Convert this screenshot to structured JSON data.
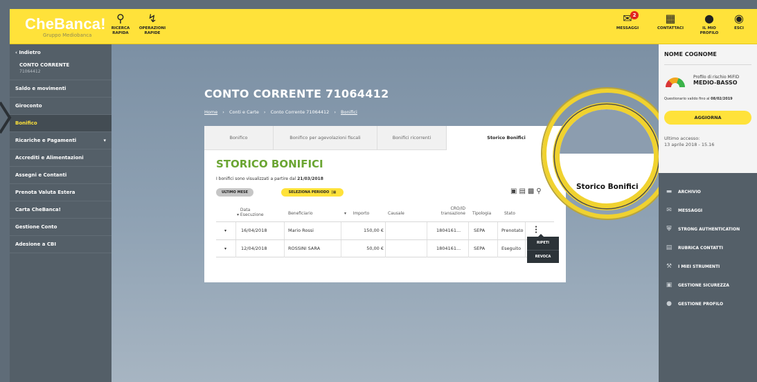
{
  "brand": {
    "name": "CheBanca!",
    "group": "Gruppo Mediobanca"
  },
  "topbar": {
    "left_items": [
      {
        "icon": "search-icon",
        "label1": "RICERCA",
        "label2": "RAPIDA"
      },
      {
        "icon": "lightning-icon",
        "label1": "OPERAZIONI",
        "label2": "RAPIDE"
      }
    ],
    "right_items": [
      {
        "icon": "message-icon",
        "label1": "MESSAGGI",
        "label2": "",
        "badge": "2"
      },
      {
        "icon": "contact-icon",
        "label1": "CONTATTACI",
        "label2": ""
      },
      {
        "icon": "user-icon",
        "label1": "IL MIO",
        "label2": "PROFILO"
      },
      {
        "icon": "exit-icon",
        "label1": "ESCI",
        "label2": ""
      }
    ]
  },
  "sidebar": {
    "back": "Indietro",
    "account_title": "CONTO CORRENTE",
    "account_number": "71064412",
    "items": [
      {
        "label": "Saldo e movimenti"
      },
      {
        "label": "Giroconto"
      },
      {
        "label": "Bonifico",
        "active": true
      },
      {
        "label": "Ricariche e Pagamenti",
        "caret": "▾"
      },
      {
        "label": "Accrediti e Alimentazioni"
      },
      {
        "label": "Assegni e Contanti"
      },
      {
        "label": "Prenota Valuta Estera"
      },
      {
        "label": "Carta CheBanca!"
      },
      {
        "label": "Gestione Conto"
      },
      {
        "label": "Adesione a CBI"
      }
    ]
  },
  "main": {
    "title": "CONTO CORRENTE 71064412",
    "breadcrumb": [
      "Home",
      "Conti e Carte",
      "Conto Corrente 71064412",
      "Bonifici"
    ],
    "tabs": [
      "Bonifico",
      "Bonifico per agevolazioni fiscali",
      "Bonifici ricorrenti",
      "Storico Bonifici"
    ],
    "heading": "STORICO BONIFICI",
    "info_prefix": "I bonifici sono visualizzati a partire dal",
    "info_date": "21/03/2018",
    "filter_last_month": "ULTIMO MESE",
    "filter_select_period": "SELEZIONA PERIODO",
    "table": {
      "headers": {
        "date": "Data Esecuzione",
        "beneficiary": "Beneficiario",
        "amount": "Importo",
        "reason": "Causale",
        "cro": "CRO/ID transazione",
        "type": "Tipologia",
        "state": "Stato"
      },
      "rows": [
        {
          "date": "16/04/2018",
          "beneficiary": "Mario Rossi",
          "amount": "150,00 €",
          "reason": "",
          "cro": "1804161...",
          "type": "SEPA",
          "state": "Prenotato"
        },
        {
          "date": "12/04/2018",
          "beneficiary": "ROSSINI SARA",
          "amount": "50,00 €",
          "reason": "",
          "cro": "1804161...",
          "type": "SEPA",
          "state": "Eseguito"
        }
      ]
    },
    "row_menu": [
      "RIPETI",
      "REVOCA"
    ],
    "magnifier_label": "Storico Bonifici"
  },
  "right_panel": {
    "name": "NOME COGNOME",
    "risk_label": "Profilo di rischio MiFID",
    "risk_value": "MEDIO-BASSO",
    "questionnaire_prefix": "Questionario valido fino al",
    "questionnaire_date": "08/02/2019",
    "update_button": "AGGIORNA",
    "last_access_label": "Ultimo accesso:",
    "last_access_value": "13 aprile 2018 - 15.16",
    "items": [
      {
        "icon": "archive-icon",
        "label": "ARCHIVIO"
      },
      {
        "icon": "mail-icon",
        "label": "MESSAGGI"
      },
      {
        "icon": "shield-icon",
        "label": "STRONG AUTHENTICATION"
      },
      {
        "icon": "addressbook-icon",
        "label": "RUBRICA CONTATTI"
      },
      {
        "icon": "wrench-icon",
        "label": "I MIEI STRUMENTI"
      },
      {
        "icon": "lock-icon",
        "label": "GESTIONE SICUREZZA"
      },
      {
        "icon": "user-icon",
        "label": "GESTIONE PROFILO"
      }
    ]
  },
  "colors": {
    "brand_yellow": "#ffe23a",
    "heading_green": "#6aa532",
    "sidebar": "#545f68"
  }
}
